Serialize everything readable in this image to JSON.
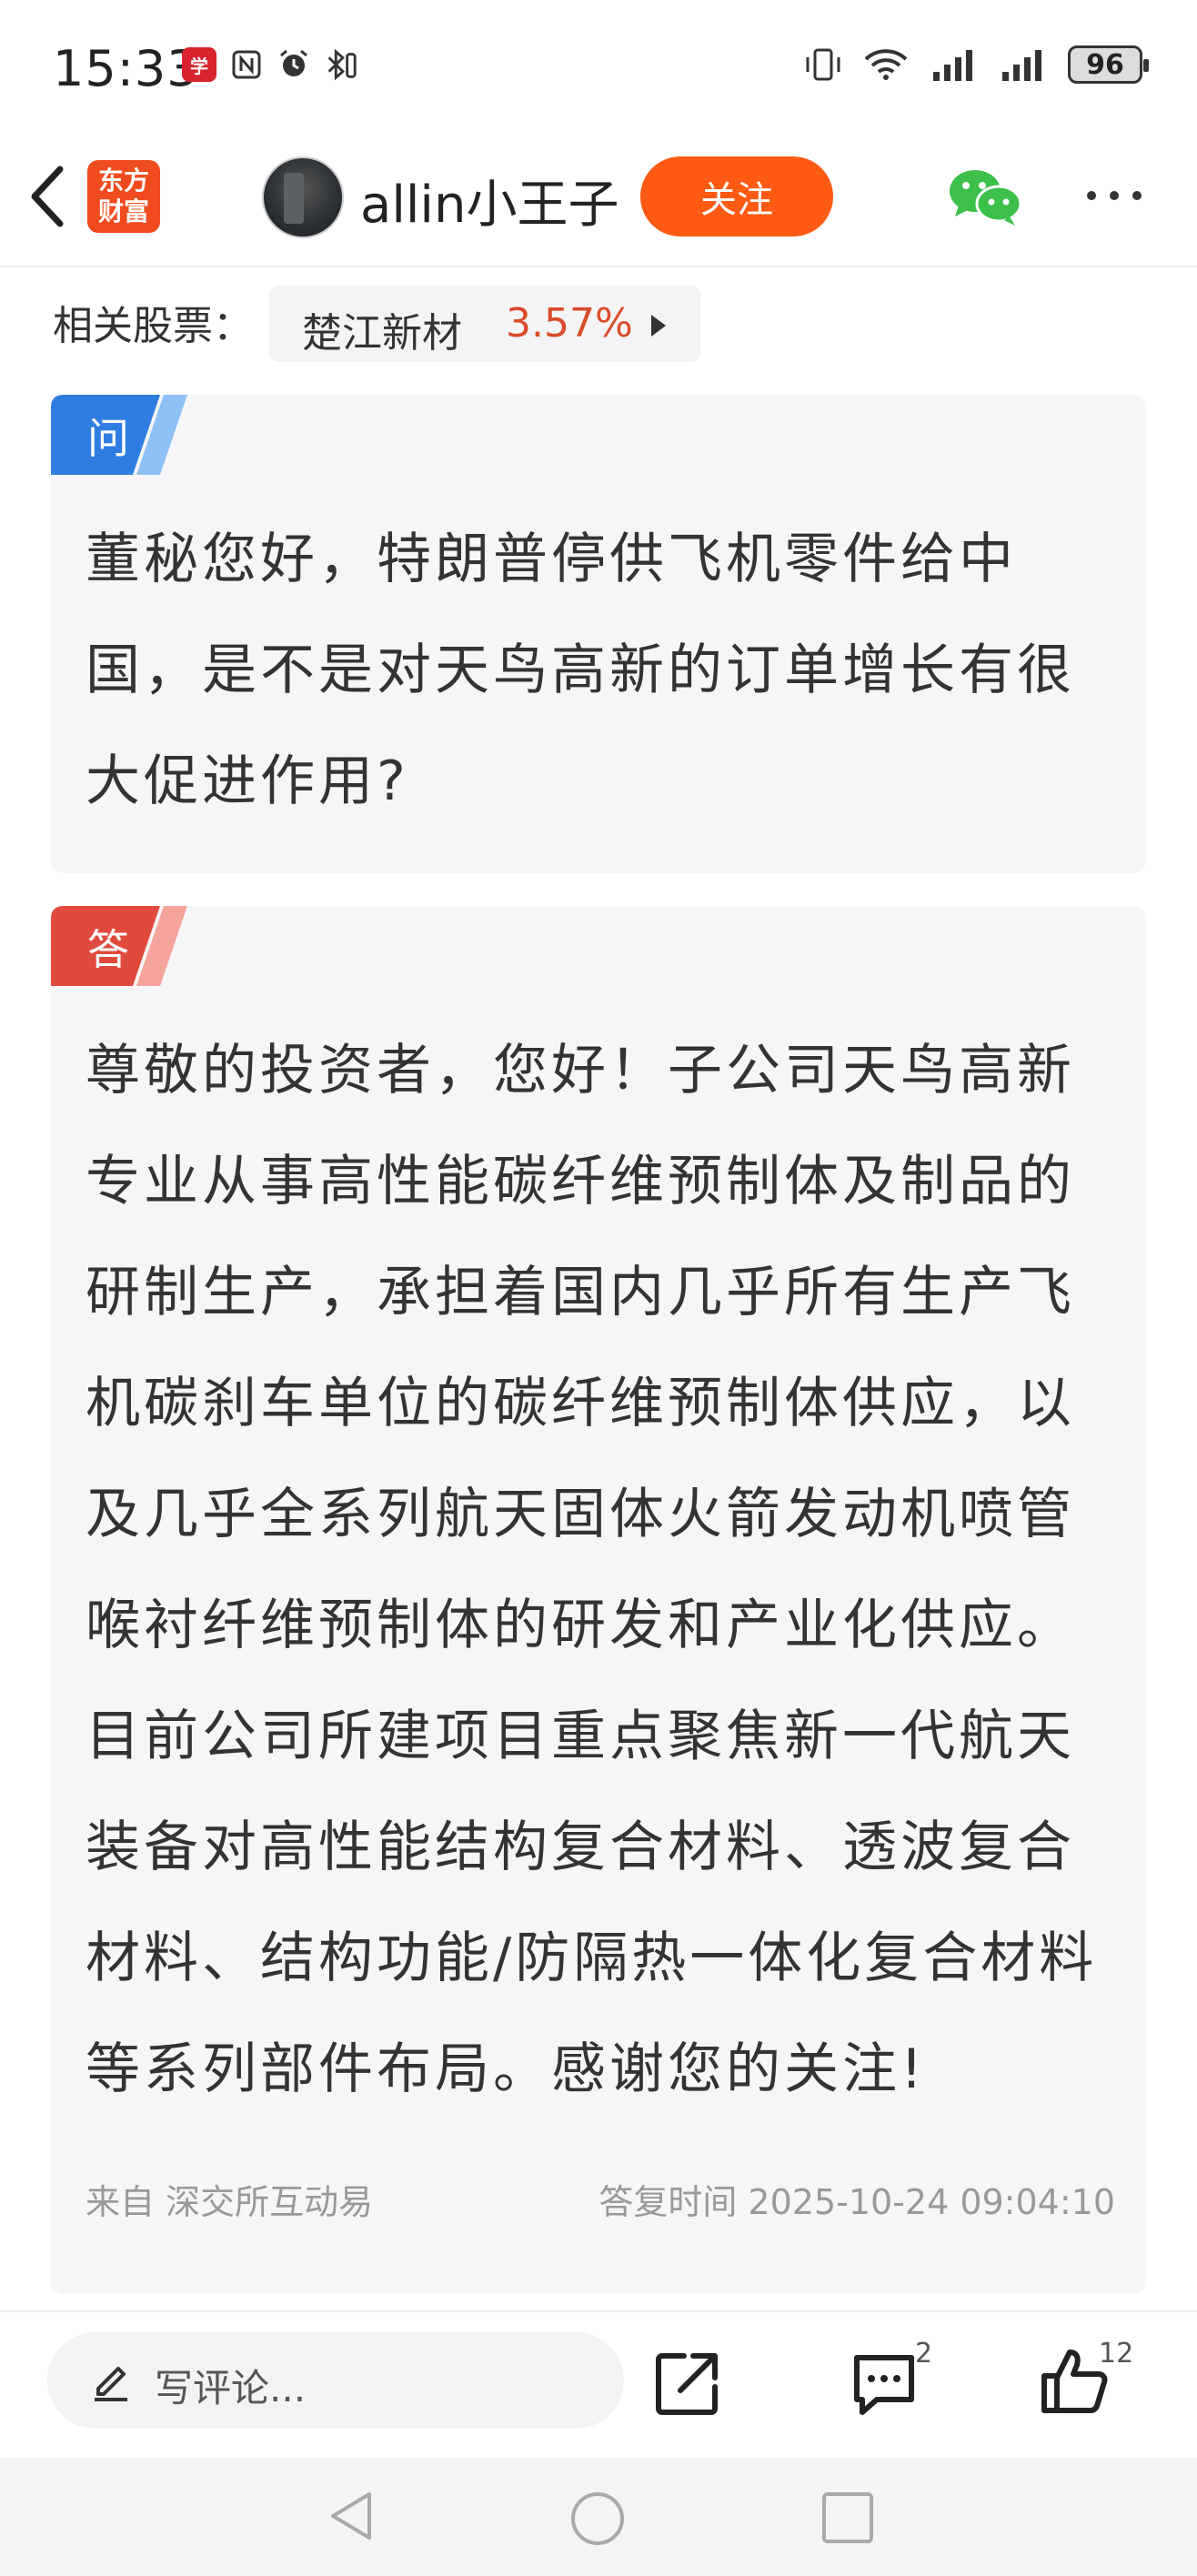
{
  "status_bar": {
    "time": "15:33",
    "left_icons": [
      "app-badge-icon",
      "nfc-icon",
      "alarm-icon",
      "bluetooth-icon"
    ],
    "right_icons": [
      "vibrate-icon",
      "wifi-icon",
      "signal-icon",
      "signal-icon"
    ],
    "battery": "96"
  },
  "header": {
    "brand_line1": "东方",
    "brand_line2": "财富",
    "username": "allin小王子",
    "follow_label": "关注",
    "icons": [
      "back-icon",
      "wechat-icon",
      "more-icon"
    ]
  },
  "related": {
    "label": "相关股票：",
    "stock_name": "楚江新材",
    "change": "3.57%",
    "accent": "#d94b2a"
  },
  "question": {
    "tag": "问",
    "tag_color": "#2f7de1",
    "text": "董秘您好，特朗普停供飞机零件给中国，是不是对天鸟高新的订单增长有很大促进作用?"
  },
  "answer": {
    "tag": "答",
    "tag_color": "#e04a3c",
    "text": "尊敬的投资者，您好！子公司天鸟高新专业从事高性能碳纤维预制体及制品的研制生产，承担着国内几乎所有生产飞机碳刹车单位的碳纤维预制体供应，以及几乎全系列航天固体火箭发动机喷管喉衬纤维预制体的研发和产业化供应。目前公司所建项目重点聚焦新一代航天装备对高性能结构复合材料、透波复合材料、结构功能/防隔热一体化复合材料等系列部件布局。感谢您的关注!",
    "source": "来自 深交所互动易",
    "reply_time": "答复时间 2025-10-24 09:04:10"
  },
  "bottom_bar": {
    "comment_placeholder": "写评论...",
    "comment_count": "2",
    "like_count": "12",
    "follow_color": "#ff5a13"
  }
}
